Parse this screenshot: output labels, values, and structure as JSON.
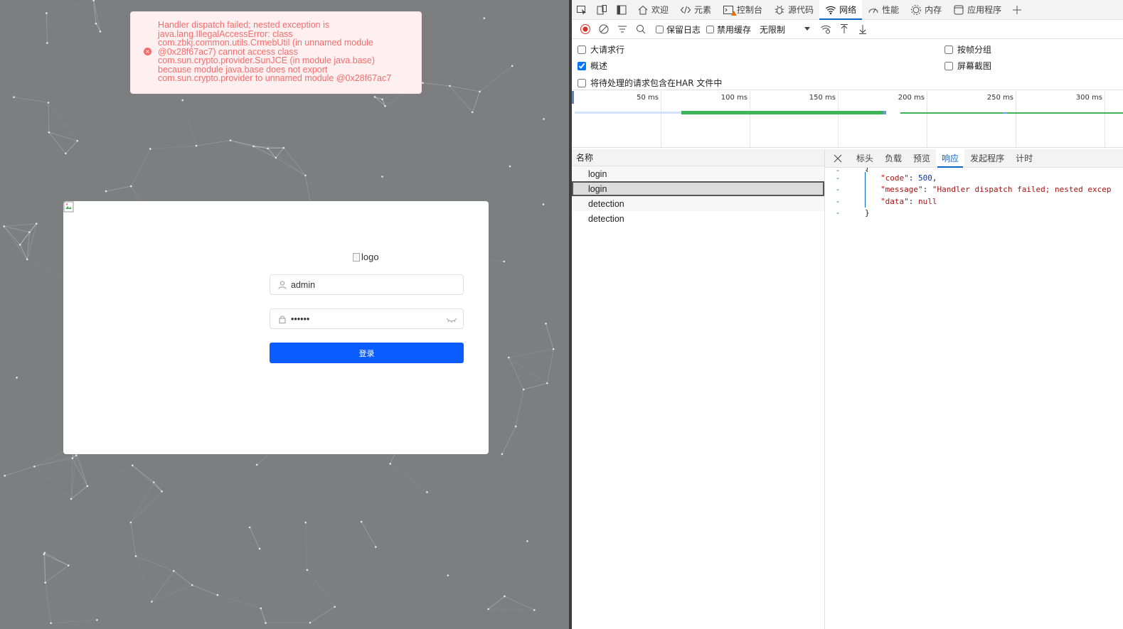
{
  "page": {
    "error_message": "Handler dispatch failed; nested exception is\njava.lang.IllegalAccessError: class\ncom.zbkj.common.utils.CrmebUtil (in unnamed module\n@0x28f67ac7) cannot access class\ncom.sun.crypto.provider.SunJCE (in module java.base)\nbecause module java.base does not export\ncom.sun.crypto.provider to unnamed module @0x28f67ac7",
    "logo_alt": "logo",
    "username_value": "admin",
    "password_value": "••••••",
    "login_label": "登录",
    "colors": {
      "background": "#7d7e80",
      "button": "#0a5cff",
      "error": "#f56c6c"
    }
  },
  "devtools": {
    "tabs": [
      {
        "label": "欢迎",
        "icon": "home-icon"
      },
      {
        "label": "元素",
        "icon": "code-icon"
      },
      {
        "label": "控制台",
        "icon": "console-icon"
      },
      {
        "label": "源代码",
        "icon": "bug-icon"
      },
      {
        "label": "网络",
        "icon": "wifi-icon",
        "active": true
      },
      {
        "label": "性能",
        "icon": "gauge-icon"
      },
      {
        "label": "内存",
        "icon": "memory-icon"
      },
      {
        "label": "应用程序",
        "icon": "app-icon"
      }
    ],
    "toolbar": {
      "preserve_log": "保留日志",
      "disable_cache": "禁用缓存",
      "throttling": "无限制"
    },
    "options": {
      "large_rows": "大请求行",
      "overview": "概述",
      "har": "将待处理的请求包含在HAR 文件中",
      "group_by_frame": "按帧分组",
      "screenshots": "屏幕截图"
    },
    "timeline_labels": [
      "50 ms",
      "100 ms",
      "150 ms",
      "200 ms",
      "250 ms",
      "300 ms"
    ],
    "requests_header": "名称",
    "requests": [
      "login",
      "login",
      "detection",
      "detection"
    ],
    "detail_tabs": [
      "标头",
      "负载",
      "预览",
      "响应",
      "发起程序",
      "计时"
    ],
    "response": {
      "code_key": "\"code\"",
      "code_val": "500",
      "message_key": "\"message\"",
      "message_val": "\"Handler dispatch failed; nested excep",
      "data_key": "\"data\"",
      "data_val": "null"
    }
  }
}
